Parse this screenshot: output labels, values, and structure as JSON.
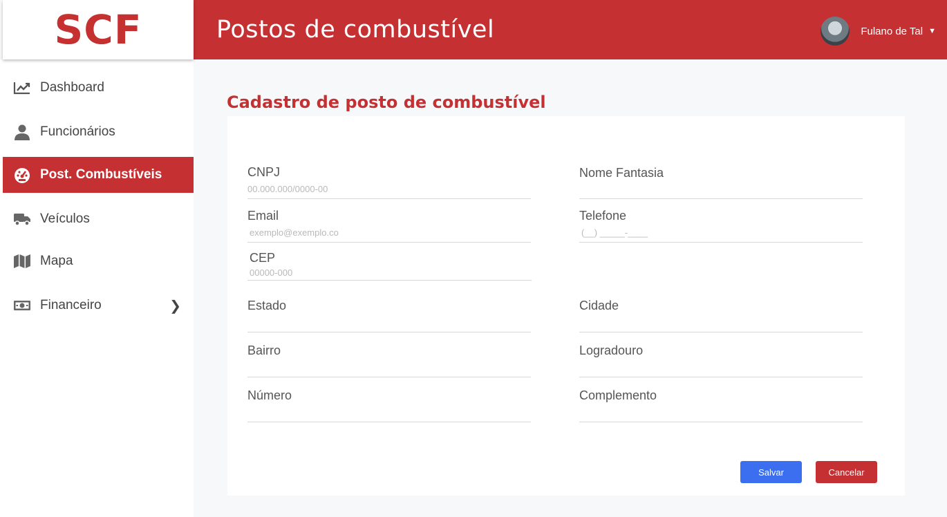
{
  "logo": "SCF",
  "header": {
    "title": "Postos de combustível",
    "user_name": "Fulano de Tal",
    "caret": "▼"
  },
  "sidebar": {
    "items": [
      {
        "label": "Dashboard",
        "icon": "chart-line-icon",
        "active": false
      },
      {
        "label": "Funcionários",
        "icon": "user-icon",
        "active": false
      },
      {
        "label": "Post. Combustíveis",
        "icon": "gauge-icon",
        "active": true
      },
      {
        "label": "Veículos",
        "icon": "truck-icon",
        "active": false
      },
      {
        "label": "Mapa",
        "icon": "map-icon",
        "active": false
      },
      {
        "label": "Financeiro",
        "icon": "money-bill-icon",
        "active": false,
        "chevron": "❯"
      }
    ]
  },
  "form": {
    "title": "Cadastro de posto de combustível",
    "fields": {
      "cnpj": {
        "label": "CNPJ",
        "placeholder": "00.000.000/0000-00",
        "value": ""
      },
      "nome_fantasia": {
        "label": "Nome Fantasia",
        "value": ""
      },
      "email": {
        "label": "Email",
        "placeholder": "exemplo@exemplo.co",
        "value": ""
      },
      "telefone": {
        "label": "Telefone",
        "placeholder": "(__) _____-____",
        "value": ""
      },
      "cep": {
        "label": "CEP",
        "placeholder": "00000-000",
        "value": ""
      },
      "estado": {
        "label": "Estado",
        "value": ""
      },
      "cidade": {
        "label": "Cidade",
        "value": ""
      },
      "bairro": {
        "label": "Bairro",
        "value": ""
      },
      "logradouro": {
        "label": "Logradouro",
        "value": ""
      },
      "numero": {
        "label": "Número",
        "value": ""
      },
      "complemento": {
        "label": "Complemento",
        "value": ""
      }
    },
    "buttons": {
      "save": "Salvar",
      "cancel": "Cancelar"
    }
  },
  "colors": {
    "brand_red": "#c53033",
    "save_blue": "#3b6ff0",
    "background": "#f7f8fa"
  }
}
